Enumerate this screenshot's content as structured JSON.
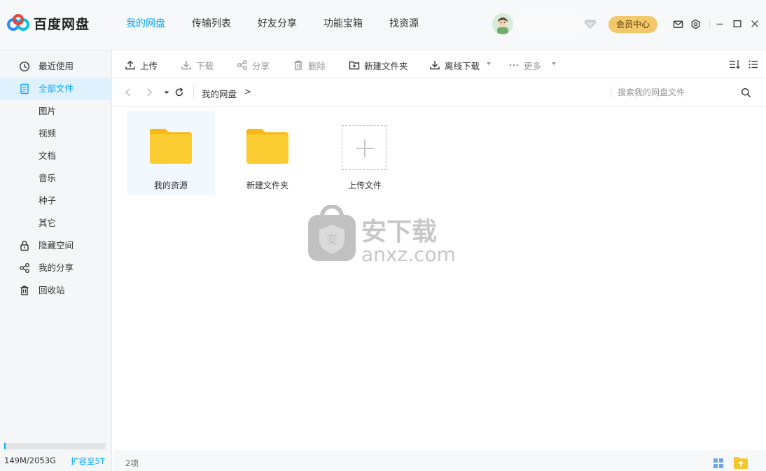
{
  "app": {
    "name": "百度网盘",
    "accent": "#06a7ff"
  },
  "nav": {
    "tabs": [
      {
        "label": "我的网盘",
        "active": true
      },
      {
        "label": "传输列表",
        "active": false
      },
      {
        "label": "好友分享",
        "active": false
      },
      {
        "label": "功能宝箱",
        "active": false
      },
      {
        "label": "找资源",
        "active": false
      }
    ]
  },
  "header": {
    "vip_button": "会员中心",
    "icons": [
      "mail-icon",
      "settings-icon",
      "minimize-icon",
      "maximize-icon",
      "close-icon"
    ]
  },
  "sidebar": {
    "items": [
      {
        "label": "最近使用",
        "icon": "clock-icon",
        "active": false
      },
      {
        "label": "全部文件",
        "icon": "document-icon",
        "active": true
      },
      {
        "label": "图片",
        "icon": "",
        "active": false
      },
      {
        "label": "视频",
        "icon": "",
        "active": false
      },
      {
        "label": "文档",
        "icon": "",
        "active": false
      },
      {
        "label": "音乐",
        "icon": "",
        "active": false
      },
      {
        "label": "种子",
        "icon": "",
        "active": false
      },
      {
        "label": "其它",
        "icon": "",
        "active": false
      },
      {
        "label": "隐藏空间",
        "icon": "lock-icon",
        "active": false
      },
      {
        "label": "我的分享",
        "icon": "share-icon",
        "active": false
      },
      {
        "label": "回收站",
        "icon": "trash-icon",
        "active": false
      }
    ],
    "quota": {
      "used_text": "149M/2053G",
      "expand_label": "扩容至5T",
      "fraction": 0.0001
    }
  },
  "toolbar": {
    "upload": "上传",
    "download": "下载",
    "share": "分享",
    "delete": "删除",
    "new_folder": "新建文件夹",
    "offline_download": "离线下载",
    "more": "更多"
  },
  "address": {
    "crumb": "我的网盘",
    "crumb_arrow": ">",
    "search_placeholder": "搜索我的网盘文件"
  },
  "files": [
    {
      "name": "我的资源",
      "type": "folder",
      "selected": true
    },
    {
      "name": "新建文件夹",
      "type": "folder",
      "selected": false
    },
    {
      "name": "上传文件",
      "type": "upload",
      "selected": false
    }
  ],
  "watermark": {
    "text_cn": "安下载",
    "text_en": "anxz.com",
    "badge": "安"
  },
  "status": {
    "count": "2项"
  },
  "colors": {
    "folder": "#f8c62b",
    "vip": "#f3c86a",
    "sidebar_active_bg": "#dff1fd"
  }
}
